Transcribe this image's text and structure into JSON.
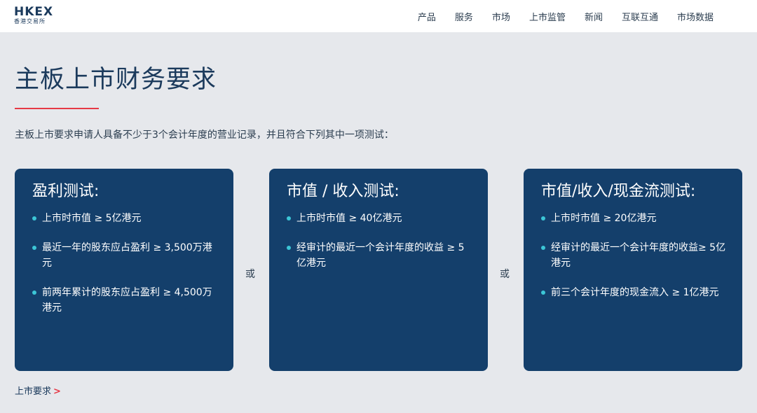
{
  "header": {
    "logo_text": "HKEX",
    "logo_sub": "香港交易所",
    "nav": [
      "产品",
      "服务",
      "市场",
      "上市监管",
      "新闻",
      "互联互通",
      "市场数据"
    ]
  },
  "page": {
    "title": "主板上市财务要求",
    "intro": "主板上市要求申请人具备不少于3个会计年度的营业记录，并且符合下列其中一项测试："
  },
  "cards": [
    {
      "title": "盈利测试:",
      "items": [
        "上市时市值 ≥ 5亿港元",
        "最近一年的股东应占盈利 ≥ 3,500万港元",
        "前两年累计的股东应占盈利 ≥ 4,500万港元"
      ]
    },
    {
      "title": "市值 / 收入测试:",
      "items": [
        "上市时市值 ≥ 40亿港元",
        "经审计的最近一个会计年度的收益 ≥ 5亿港元"
      ]
    },
    {
      "title": "市值/收入/现金流测试:",
      "items": [
        "上市时市值 ≥ 20亿港元",
        "经审计的最近一个会计年度的收益≥ 5亿港元",
        "前三个会计年度的现金流入 ≥ 1亿港元"
      ]
    }
  ],
  "separators": [
    "或",
    "或"
  ],
  "footer_link": {
    "label": "上市要求",
    "arrow": ">"
  },
  "colors": {
    "background": "#e6e8ec",
    "card": "#143f6b",
    "accent": "#e63946",
    "bullet": "#3cc6d6"
  }
}
